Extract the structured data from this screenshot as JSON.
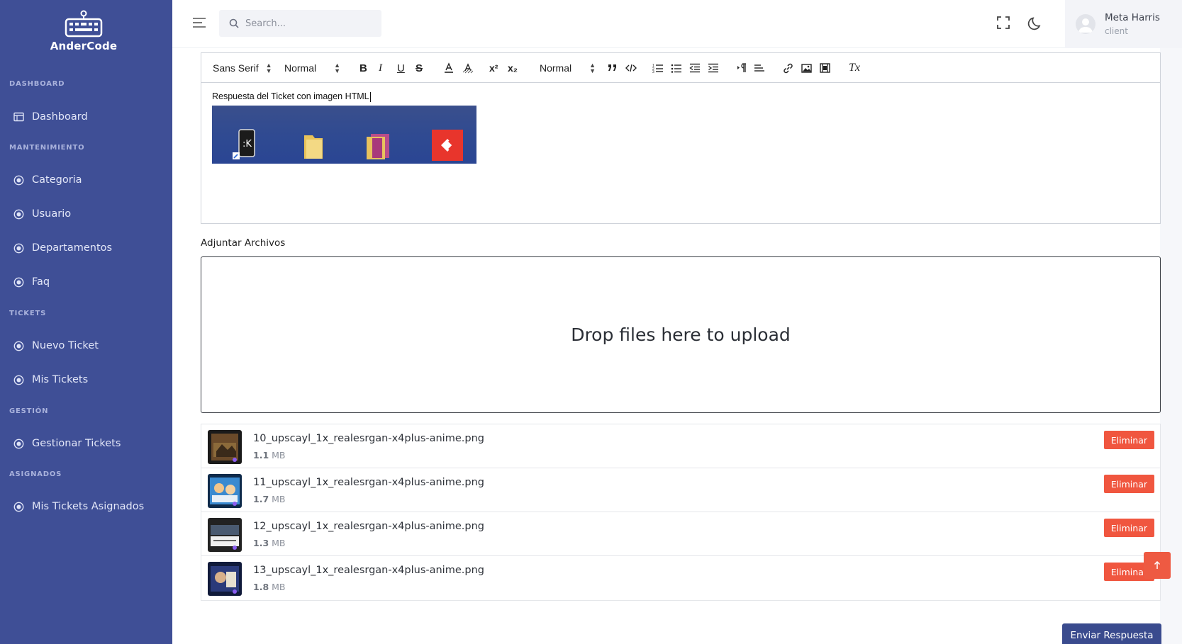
{
  "brand": {
    "name": "AnderCode"
  },
  "sidebar": {
    "sections": [
      {
        "title": "DASHBOARD"
      },
      {
        "title": "MANTENIMIENTO"
      },
      {
        "title": "TICKETS"
      },
      {
        "title": "GESTIÓN"
      },
      {
        "title": "ASIGNADOS"
      }
    ],
    "items": [
      {
        "label": "Dashboard",
        "icon": "calendar-icon"
      },
      {
        "label": "Categoria",
        "icon": "circle-bullet-icon"
      },
      {
        "label": "Usuario",
        "icon": "circle-bullet-icon"
      },
      {
        "label": "Departamentos",
        "icon": "circle-bullet-icon"
      },
      {
        "label": "Faq",
        "icon": "circle-bullet-icon"
      },
      {
        "label": "Nuevo Ticket",
        "icon": "circle-bullet-icon"
      },
      {
        "label": "Mis Tickets",
        "icon": "circle-bullet-icon"
      },
      {
        "label": "Gestionar Tickets",
        "icon": "circle-bullet-icon"
      },
      {
        "label": "Mis Tickets Asignados",
        "icon": "circle-bullet-icon"
      }
    ]
  },
  "header": {
    "search_placeholder": "Search...",
    "user": {
      "name": "Meta Harris",
      "role": "client"
    }
  },
  "editor": {
    "font_family": "Sans Serif",
    "font_size": "Normal",
    "heading": "Normal",
    "bold": "B",
    "italic": "I",
    "underline": "U",
    "strike": "S",
    "superscript": "x²",
    "subscript": "x₂",
    "clear_format": "Tx",
    "content_text": "Respuesta del Ticket  con imagen HTML"
  },
  "attachments": {
    "label": "Adjuntar Archivos",
    "dropzone_message": "Drop files here to upload",
    "files": [
      {
        "name": "10_upscayl_1x_realesrgan-x4plus-anime.png",
        "size_value": "1.1",
        "size_unit": "MB"
      },
      {
        "name": "11_upscayl_1x_realesrgan-x4plus-anime.png",
        "size_value": "1.7",
        "size_unit": "MB"
      },
      {
        "name": "12_upscayl_1x_realesrgan-x4plus-anime.png",
        "size_value": "1.3",
        "size_unit": "MB"
      },
      {
        "name": "13_upscayl_1x_realesrgan-x4plus-anime.png",
        "size_value": "1.8",
        "size_unit": "MB"
      }
    ],
    "delete_label": "Eliminar"
  },
  "actions": {
    "submit_label": "Enviar Respuesta"
  },
  "colors": {
    "sidebar": "#3f4f96",
    "danger": "#f0563f",
    "primary_button": "#3a4b8e"
  }
}
